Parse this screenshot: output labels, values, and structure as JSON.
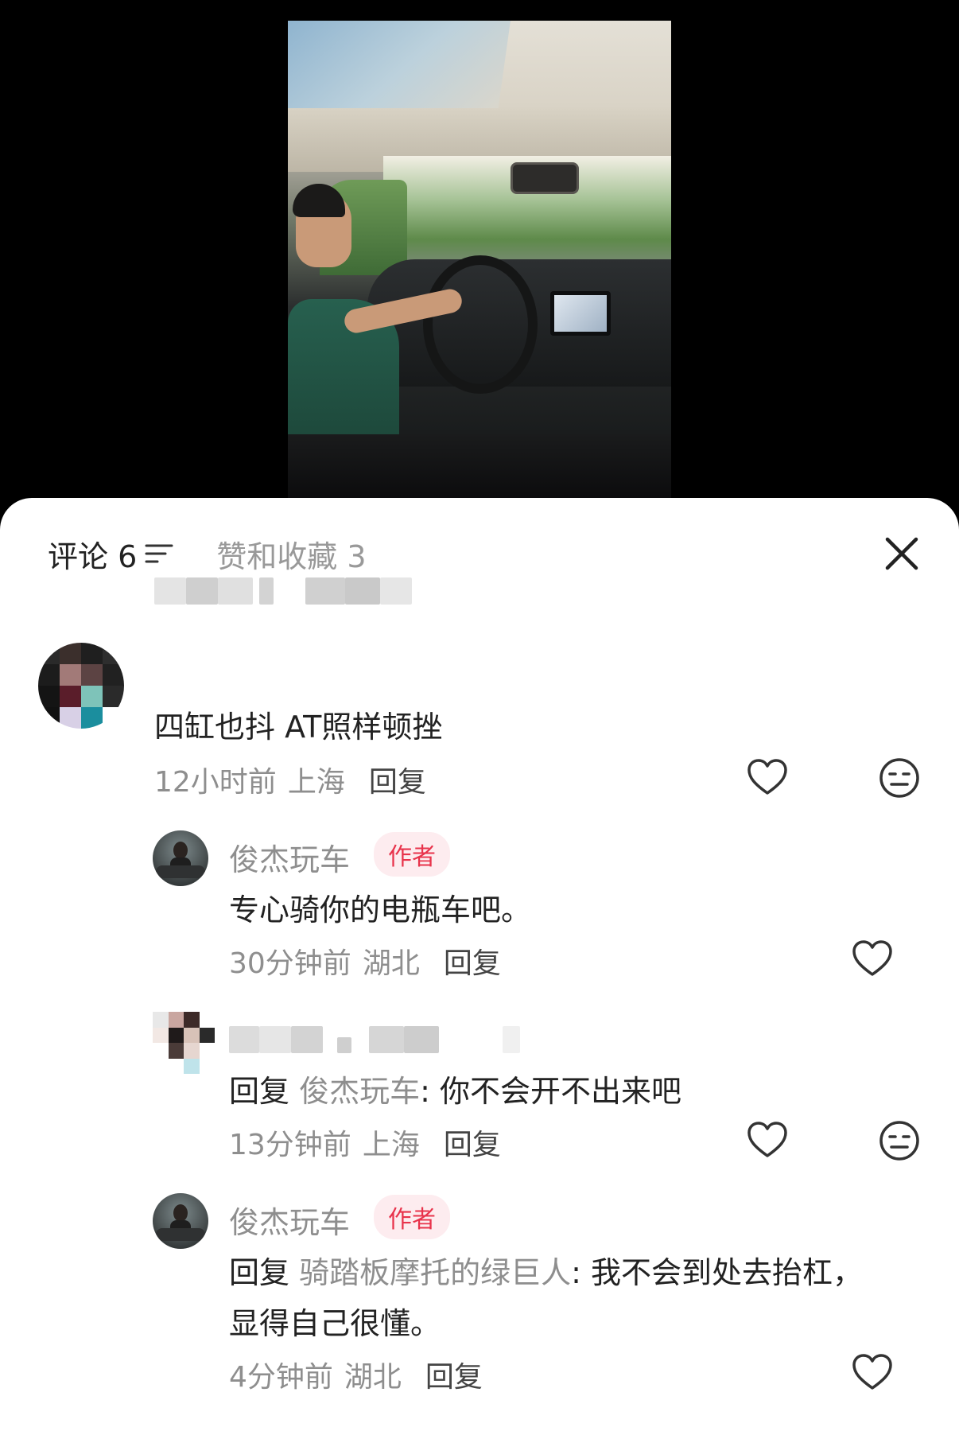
{
  "tabs": {
    "comments_label": "评论 6",
    "likes_label": "赞和收藏 3"
  },
  "comments": [
    {
      "text": "四缸也抖 AT照样顿挫",
      "time": "12小时前",
      "location": "上海",
      "reply_label": "回复"
    },
    {
      "name": "俊杰玩车",
      "badge": "作者",
      "text": "专心骑你的电瓶车吧。",
      "time": "30分钟前",
      "location": "湖北",
      "reply_label": "回复"
    },
    {
      "reply_prefix": "回复",
      "reply_to": "俊杰玩车",
      "text": ": 你不会开不出来吧",
      "time": "13分钟前",
      "location": "上海",
      "reply_label": "回复"
    },
    {
      "name": "俊杰玩车",
      "badge": "作者",
      "reply_prefix": "回复",
      "reply_to": "骑踏板摩托的绿巨人",
      "text_line1": ": 我不会到处去抬杠，",
      "text_line2": "显得自己很懂。",
      "time": "4分钟前",
      "location": "湖北",
      "reply_label": "回复"
    }
  ],
  "icons": {
    "like": "heart-outline-icon",
    "dislike": "meh-face-icon",
    "close": "close-icon",
    "sort": "filter-lines-icon"
  },
  "colors": {
    "author_badge_text": "#e8334b",
    "author_badge_bg": "#fdecef",
    "secondary_text": "#8e8e8e"
  }
}
